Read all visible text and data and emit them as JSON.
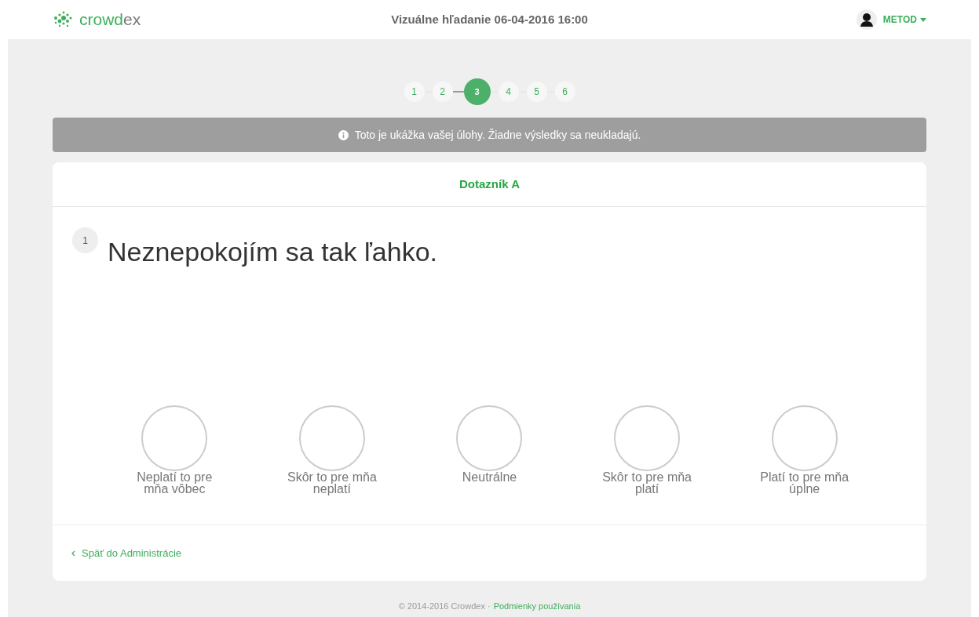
{
  "header": {
    "logo": [
      "crowd",
      "ex"
    ],
    "title": "Vizuálne hľadanie 06-04-2016 16:00",
    "user": "METOD"
  },
  "steps": [
    {
      "label": "1",
      "selected": false
    },
    {
      "label": "2",
      "selected": false
    },
    {
      "label": "3",
      "selected": true
    },
    {
      "label": "4",
      "selected": false
    },
    {
      "label": "5",
      "selected": false
    },
    {
      "label": "6",
      "selected": false
    }
  ],
  "notice": "Toto je ukážka vašej úlohy. Žiadne výsledky sa neukladajú.",
  "card": {
    "title": "Dotazník A",
    "question_number": "1",
    "question": "Neznepokojím sa tak ľahko.",
    "options": [
      {
        "label": "Neplatí to pre mňa vôbec",
        "selected": false
      },
      {
        "label": "Skôr to pre mňa neplatí",
        "selected": false
      },
      {
        "label": "Neutrálne",
        "selected": false
      },
      {
        "label": "Skôr to pre mňa platí",
        "selected": false
      },
      {
        "label": "Platí to pre mňa úplne",
        "selected": false
      }
    ],
    "back_link": "Späť do Administrácie"
  },
  "footer": {
    "copyright": "© 2014-2016 Crowdex ·",
    "link": "Podmienky používania"
  }
}
